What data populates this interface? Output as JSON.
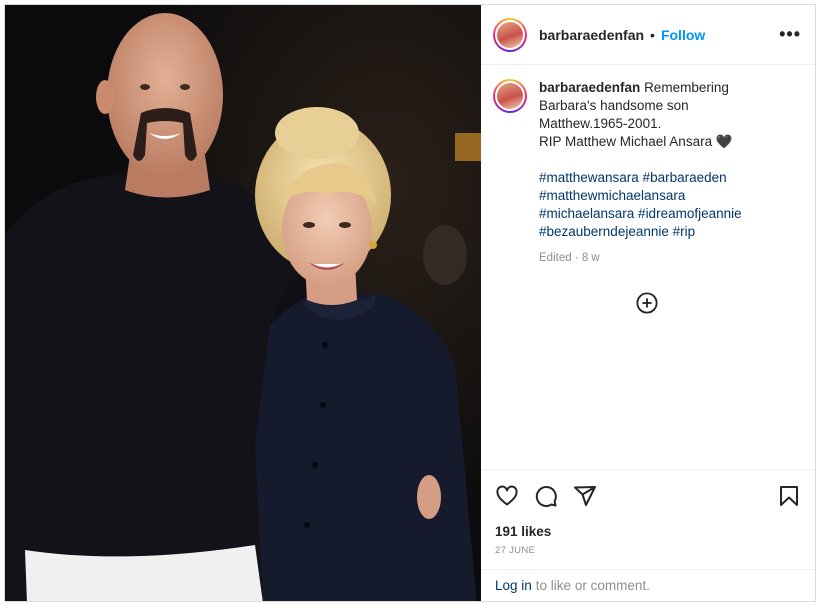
{
  "post": {
    "username": "barbaraedenfan",
    "follow_label": "Follow",
    "separator": "•",
    "more_label": "•••",
    "caption_lines": [
      "Remembering",
      "Barbara's handsome son",
      "Matthew.1965-2001.",
      "RIP Matthew Michael Ansara 🖤"
    ],
    "hashtags_lines": [
      "#matthewansara #barbaraeden",
      "#matthewmichaelansara",
      "#michaelansara #idreamofjeannie",
      "#bezauberndejeannie #rip"
    ],
    "edited": "Edited · 8 w",
    "likes": "191 likes",
    "date": "27 JUNE",
    "login_link": "Log in",
    "login_rest": "to like or comment."
  },
  "icons": [
    "heart-icon",
    "comment-icon",
    "share-icon",
    "bookmark-icon",
    "plus-circle-icon",
    "more-icon"
  ],
  "colors": {
    "accent": "#0095f6",
    "hashtag": "#00376b",
    "muted": "#8e8e8e",
    "photo_bg": "#0b0b0d"
  }
}
